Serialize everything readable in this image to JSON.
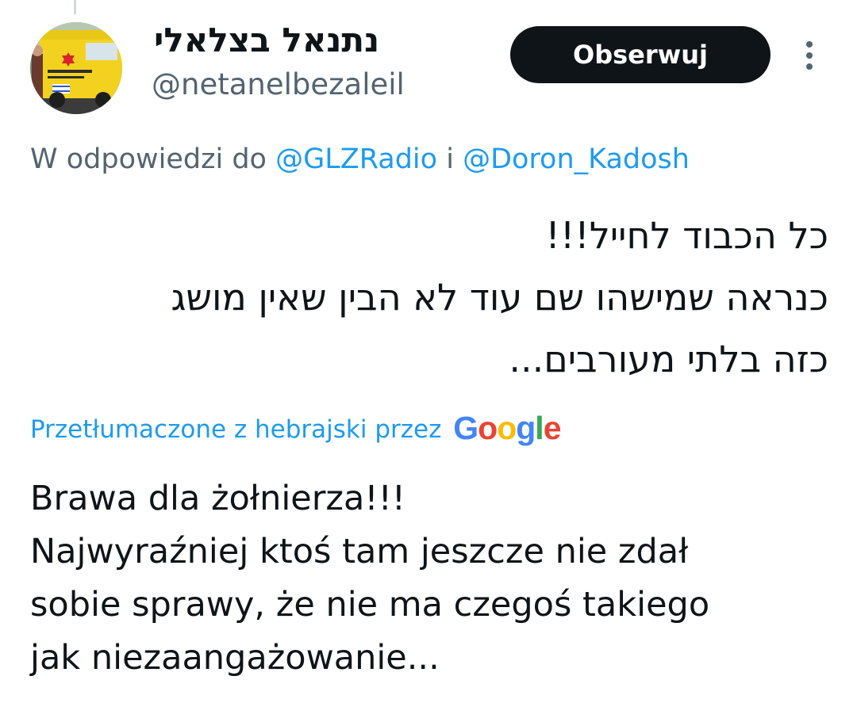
{
  "tweet": {
    "author": {
      "display_name": "נתנאל בצלאלי",
      "handle": "@netanelbezaleil"
    },
    "follow_label": "Obserwuj",
    "reply_context": {
      "prefix": "W odpowiedzi do",
      "mention_1": "@GLZRadio",
      "connector": "i",
      "mention_2": "@Doron_Kadosh"
    },
    "original_lines": [
      "כל הכבוד לחייל!!!",
      "כנראה שמישהו שם עוד לא הבין שאין מושג",
      "כזה בלתי מעורבים..."
    ],
    "translation_note": "Przetłumaczone z hebrajski przez",
    "translation_logo": {
      "letters": [
        "G",
        "o",
        "o",
        "g",
        "l",
        "e"
      ],
      "colors": [
        "#4285f4",
        "#ea4335",
        "#fbbc05",
        "#4285f4",
        "#34a853",
        "#ea4335"
      ]
    },
    "translated_lines": [
      "Brawa dla żołnierza!!!",
      "Najwyraźniej ktoś tam jeszcze nie zdał",
      "sobie sprawy, że nie ma czegoś takiego",
      "jak niezaangażowanie..."
    ]
  },
  "colors": {
    "accent": "#1d9bf0",
    "secondary_text": "#536471",
    "button_bg": "#0f1419",
    "ambulance_yellow": "#f2d21f"
  }
}
